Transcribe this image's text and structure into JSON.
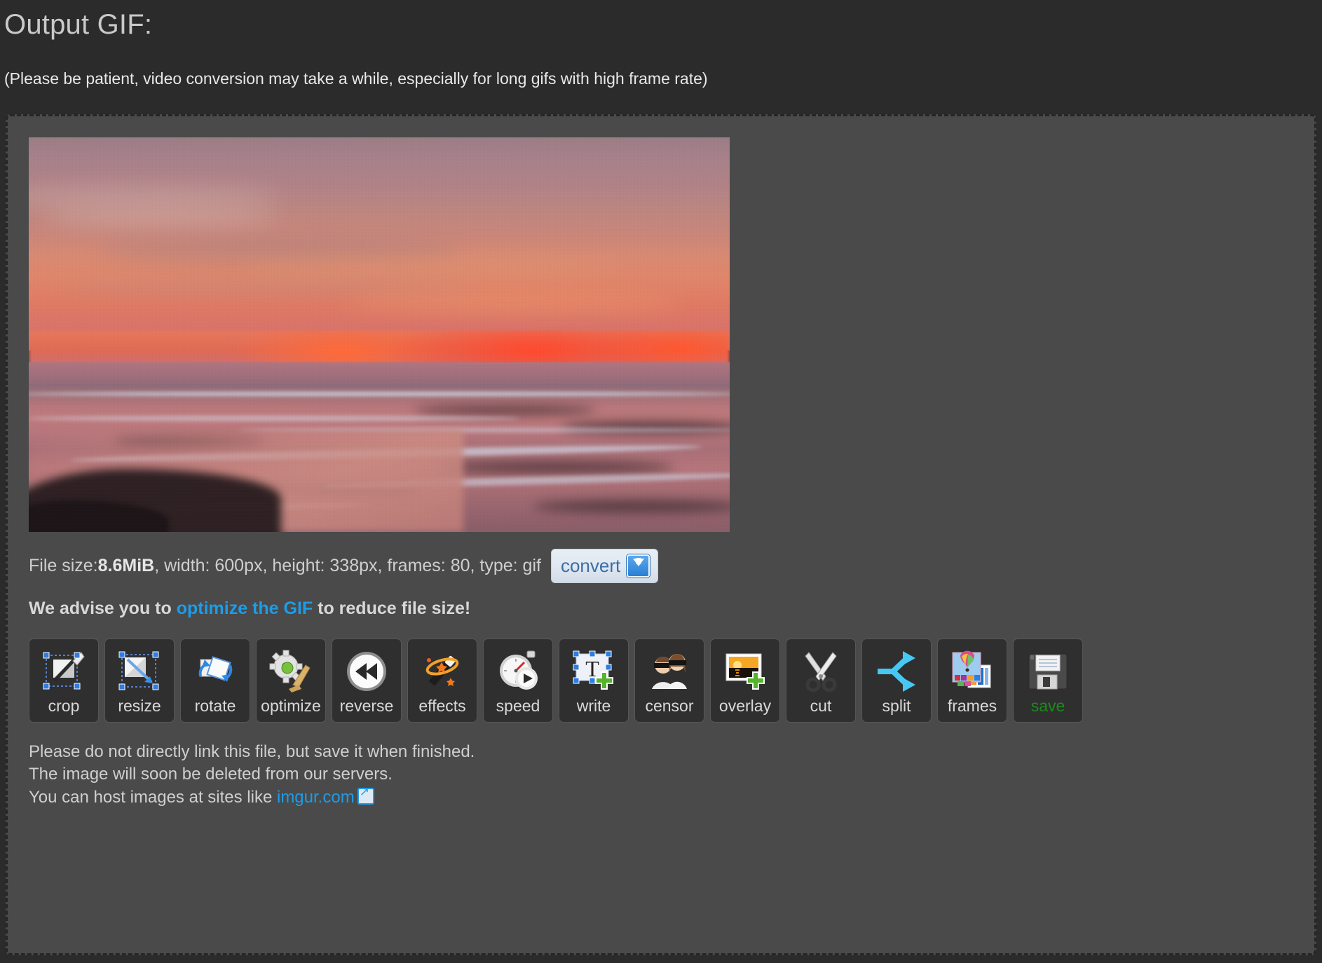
{
  "header": {
    "title": "Output GIF:",
    "note": "(Please be patient, video conversion may take a while, especially for long gifs with high frame rate)"
  },
  "preview": {
    "alt": "sunset-beach-gif-preview"
  },
  "file_info": {
    "prefix": "File size: ",
    "filesize": "8.6MiB",
    "details": ", width: 600px, height: 338px, frames: 80, type: gif",
    "convert_label": "convert",
    "download_icon": "download-icon"
  },
  "advise": {
    "before": "We advise you to ",
    "link": "optimize the GIF",
    "after": " to reduce file size!"
  },
  "toolbar": {
    "items": [
      {
        "label": "crop",
        "icon": "crop-icon"
      },
      {
        "label": "resize",
        "icon": "resize-icon"
      },
      {
        "label": "rotate",
        "icon": "rotate-icon"
      },
      {
        "label": "optimize",
        "icon": "optimize-icon"
      },
      {
        "label": "reverse",
        "icon": "reverse-icon"
      },
      {
        "label": "effects",
        "icon": "effects-icon"
      },
      {
        "label": "speed",
        "icon": "speed-icon"
      },
      {
        "label": "write",
        "icon": "write-icon"
      },
      {
        "label": "censor",
        "icon": "censor-icon"
      },
      {
        "label": "overlay",
        "icon": "overlay-icon"
      },
      {
        "label": "cut",
        "icon": "cut-icon"
      },
      {
        "label": "split",
        "icon": "split-icon"
      },
      {
        "label": "frames",
        "icon": "frames-icon"
      },
      {
        "label": "save",
        "icon": "save-icon"
      }
    ]
  },
  "footer": {
    "line1": "Please do not directly link this file, but save it when finished.",
    "line2": "The image will soon be deleted from our servers.",
    "line3_before": "You can host images at sites like ",
    "line3_link": "imgur.com",
    "external_icon": "external-link-icon"
  },
  "colors": {
    "page_bg": "#2b2b2b",
    "panel_bg": "#4a4a4a",
    "link": "#1e9ce8",
    "save_label": "#1d8a1d",
    "button_bg": "#2f2f2f"
  }
}
